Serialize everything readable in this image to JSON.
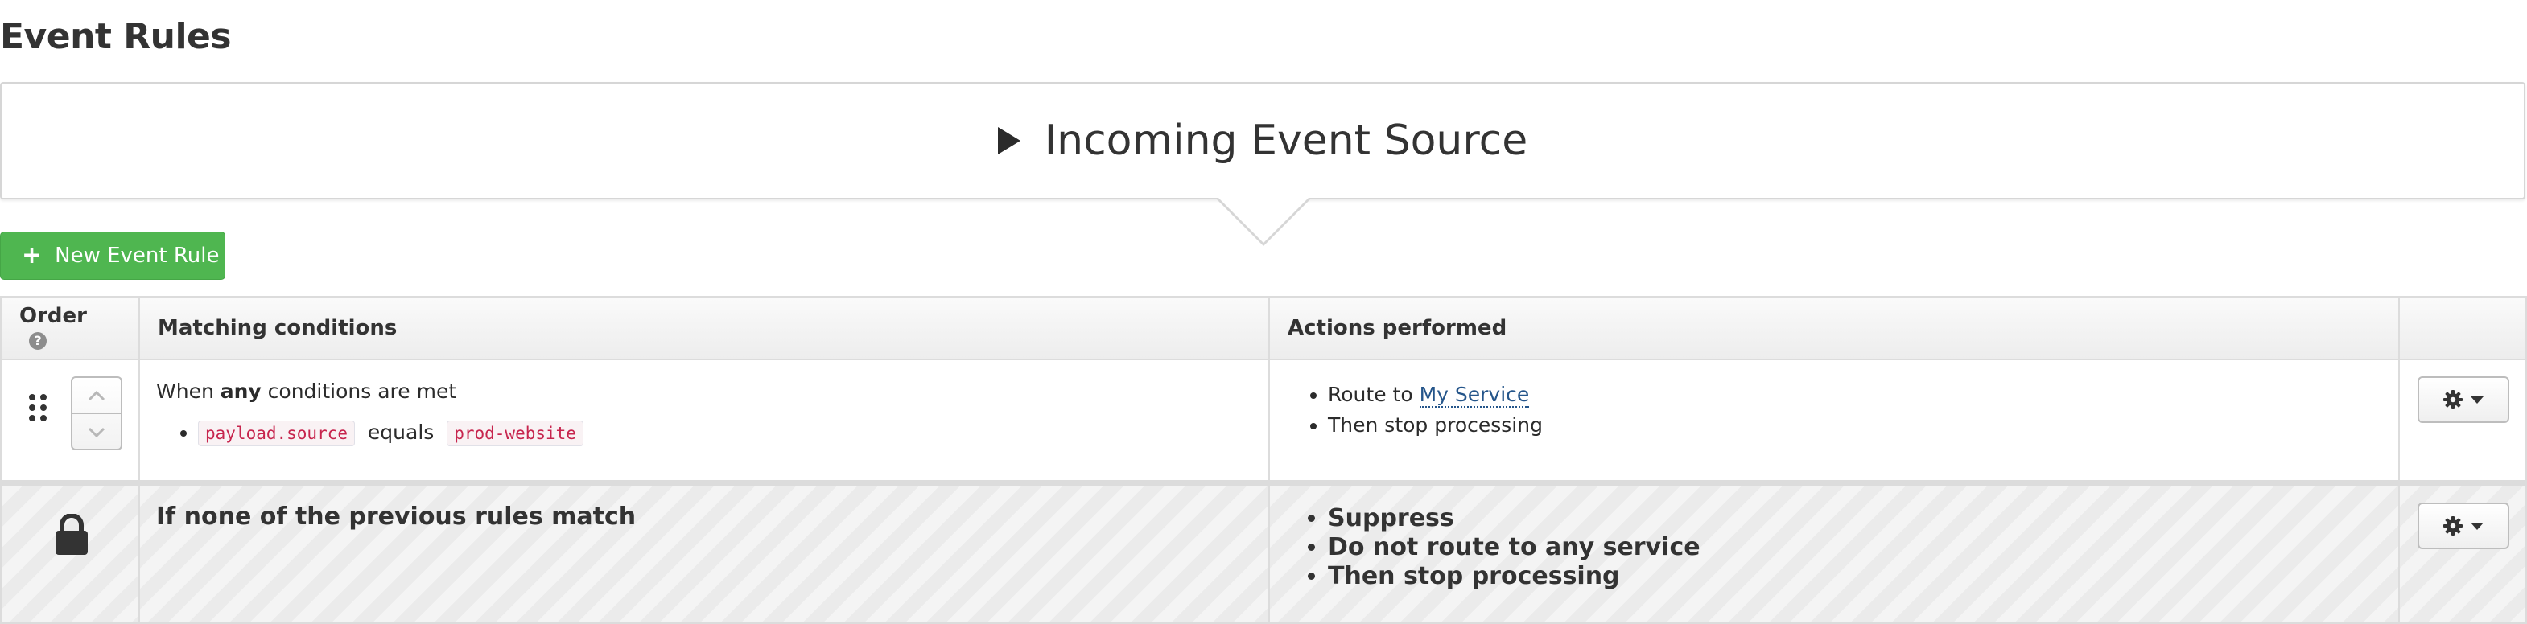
{
  "page": {
    "title": "Event Rules"
  },
  "source_panel": {
    "label": "Incoming Event Source"
  },
  "toolbar": {
    "new_rule_label": "New Event Rule"
  },
  "table": {
    "headers": {
      "order": "Order",
      "conditions": "Matching conditions",
      "actions": "Actions performed"
    }
  },
  "rules": [
    {
      "condition_prefix": "When ",
      "condition_keyword": "any",
      "condition_suffix": " conditions are met",
      "conditions": [
        {
          "field": "payload.source",
          "operator": "equals",
          "value": "prod-website"
        }
      ],
      "actions": {
        "route_prefix": "Route to ",
        "route_target": "My Service",
        "stop": "Then stop processing"
      }
    }
  ],
  "default_rule": {
    "condition": "If none of the previous rules match",
    "actions": [
      "Suppress",
      "Do not route to any service",
      "Then stop processing"
    ]
  },
  "icons": {
    "new_rule": "plus-icon",
    "help": "question-circle-icon",
    "drag": "drag-handle-icon",
    "up": "chevron-up-icon",
    "down": "chevron-down-icon",
    "menu": "gear-icon",
    "lock": "lock-icon"
  },
  "colors": {
    "primary_button": "#4fb650",
    "link": "#24558a",
    "code_text": "#c7254e"
  }
}
